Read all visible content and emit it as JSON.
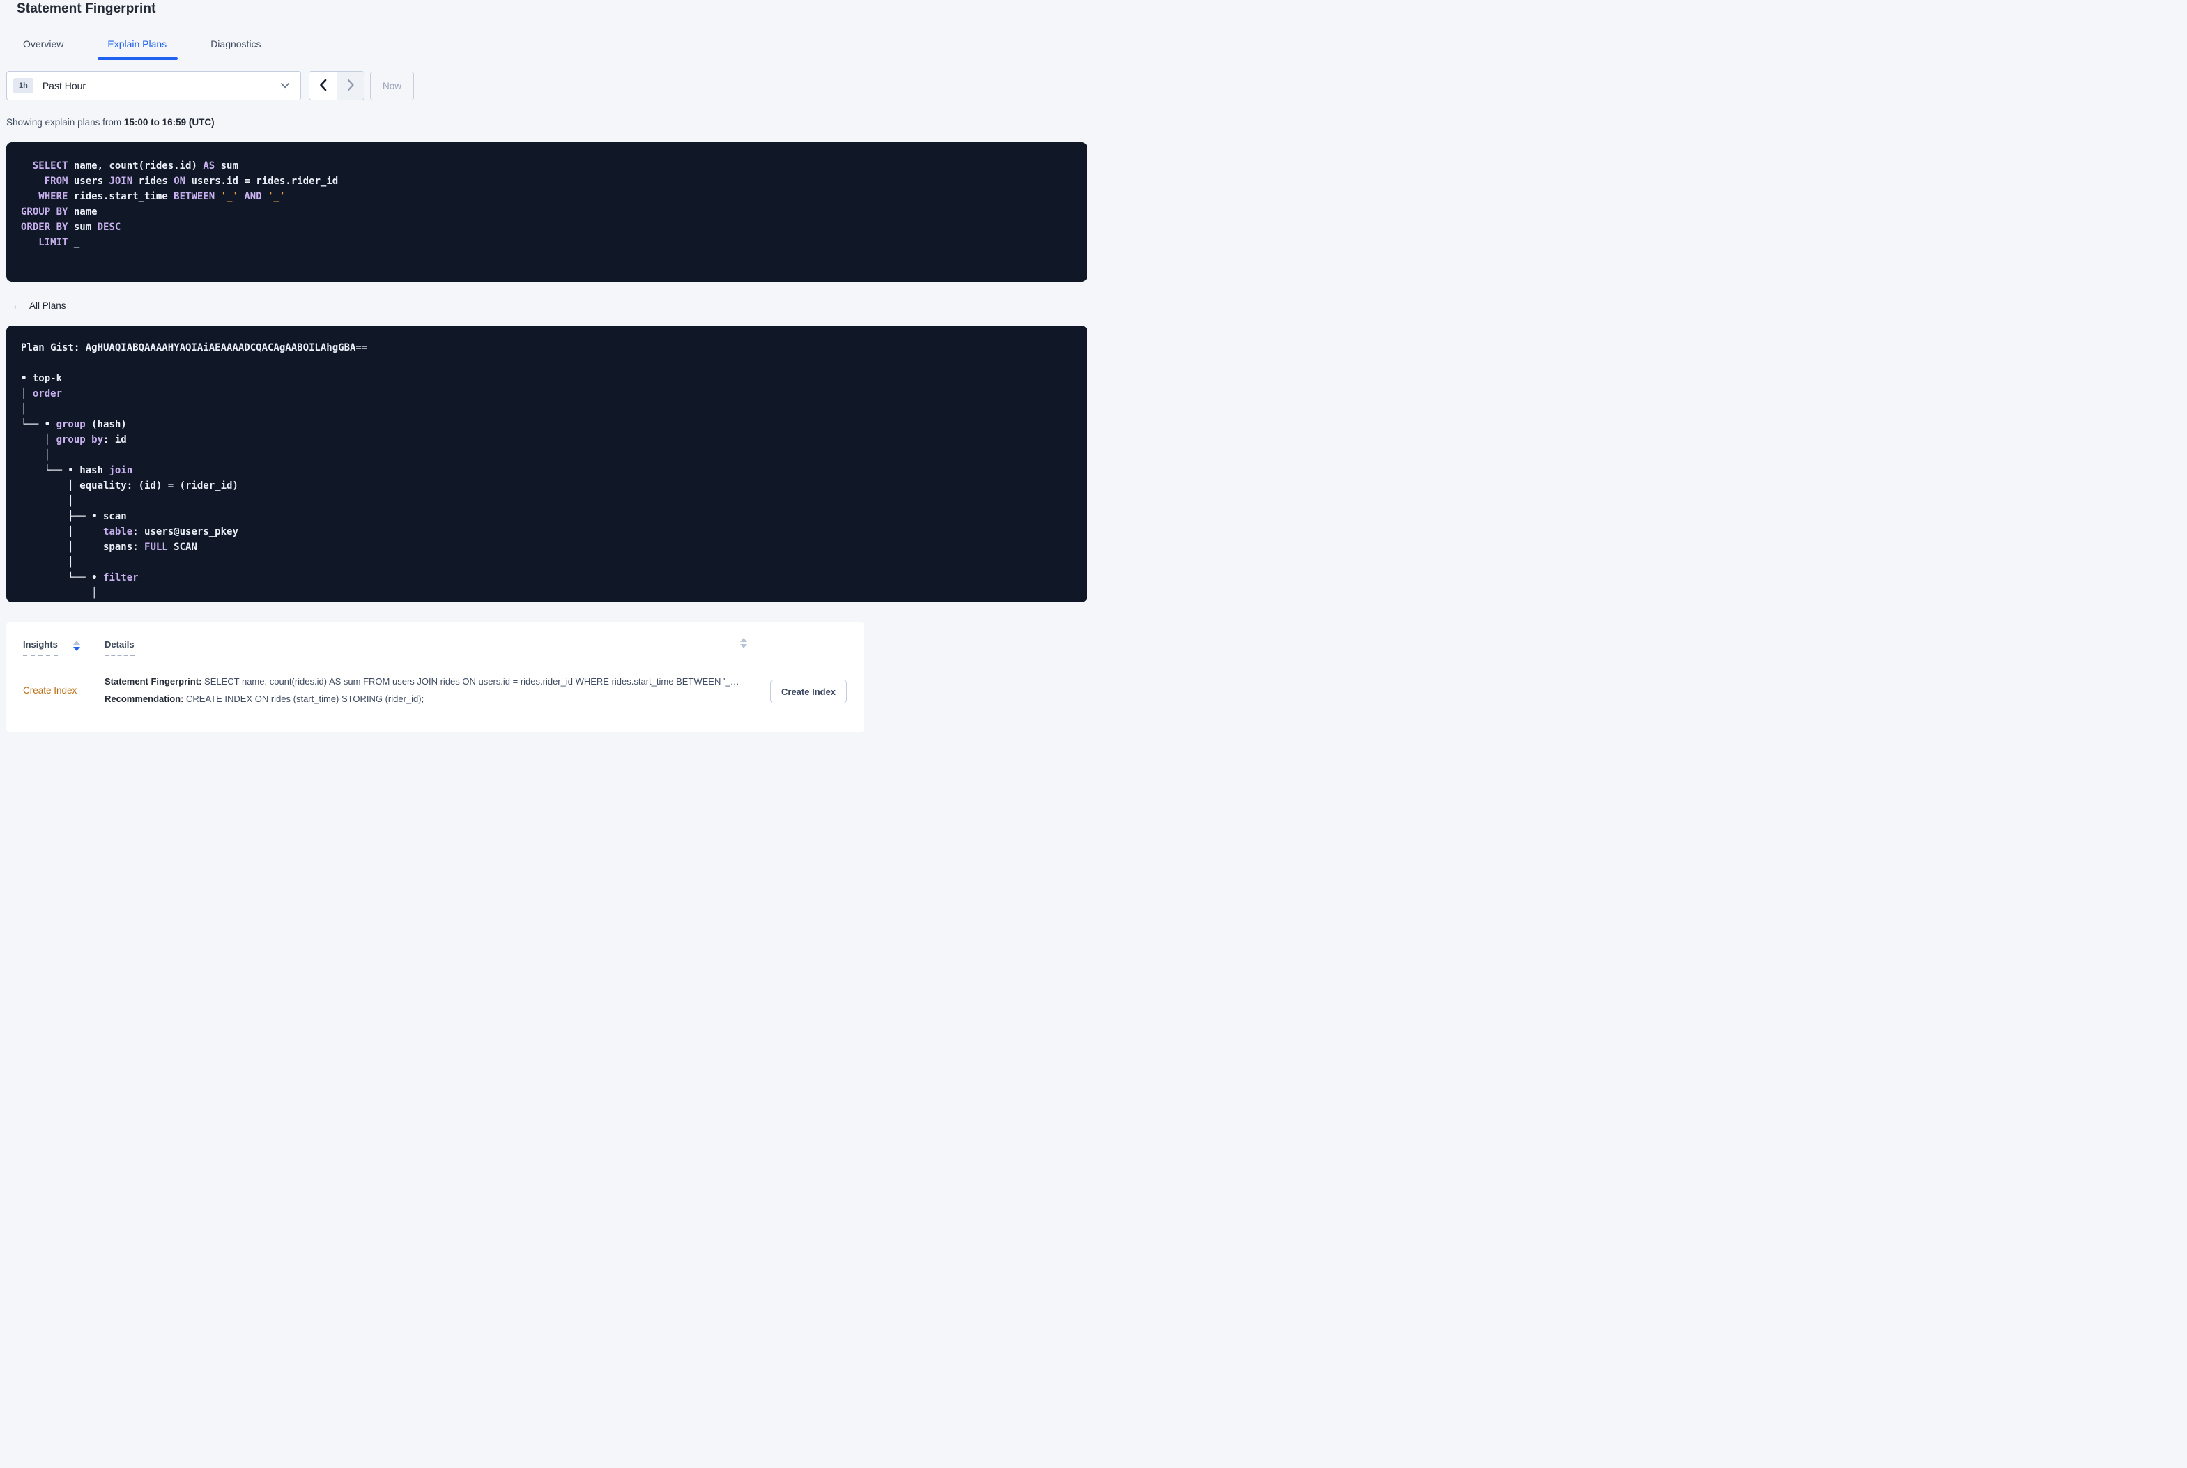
{
  "header": {
    "title": "Statement Fingerprint"
  },
  "tabs": [
    {
      "label": "Overview",
      "active": false
    },
    {
      "label": "Explain Plans",
      "active": true
    },
    {
      "label": "Diagnostics",
      "active": false
    }
  ],
  "time_picker": {
    "interval_badge": "1h",
    "selected_range": "Past Hour",
    "now_label": "Now"
  },
  "summary": {
    "prefix": "Showing explain plans from ",
    "range_bold": "15:00 to 16:59 (UTC)"
  },
  "sql": {
    "lines": [
      [
        [
          "p",
          "  "
        ],
        [
          "k",
          "SELECT"
        ],
        [
          "p",
          " name, count(rides.id) "
        ],
        [
          "k",
          "AS"
        ],
        [
          "p",
          " sum"
        ]
      ],
      [
        [
          "p",
          "    "
        ],
        [
          "k",
          "FROM"
        ],
        [
          "p",
          " users "
        ],
        [
          "k",
          "JOIN"
        ],
        [
          "p",
          " rides "
        ],
        [
          "k",
          "ON"
        ],
        [
          "p",
          " users.id = rides.rider_id"
        ]
      ],
      [
        [
          "p",
          "   "
        ],
        [
          "k",
          "WHERE"
        ],
        [
          "p",
          " rides.start_time "
        ],
        [
          "k",
          "BETWEEN"
        ],
        [
          "p",
          " "
        ],
        [
          "l",
          "'_'"
        ],
        [
          "p",
          " "
        ],
        [
          "k",
          "AND"
        ],
        [
          "p",
          " "
        ],
        [
          "l",
          "'_'"
        ]
      ],
      [
        [
          "k",
          "GROUP BY"
        ],
        [
          "p",
          " name"
        ]
      ],
      [
        [
          "k",
          "ORDER BY"
        ],
        [
          "p",
          " sum "
        ],
        [
          "k",
          "DESC"
        ]
      ],
      [
        [
          "p",
          "   "
        ],
        [
          "k",
          "LIMIT"
        ],
        [
          "p",
          " _"
        ]
      ]
    ]
  },
  "plans_nav": {
    "back_icon": "←",
    "back_label": "All Plans"
  },
  "plan": {
    "gist_line": "Plan Gist: AgHUAQIABQAAAAHYAQIAiAEAAAADCQACAgAABQILAhgGBA==",
    "tree_lines": [
      [
        [
          "p",
          "• top-k"
        ]
      ],
      [
        [
          "p",
          "│ "
        ],
        [
          "k",
          "order"
        ]
      ],
      [
        [
          "p",
          "│"
        ]
      ],
      [
        [
          "p",
          "└── • "
        ],
        [
          "k",
          "group"
        ],
        [
          "p",
          " (hash)"
        ]
      ],
      [
        [
          "p",
          "    │ "
        ],
        [
          "k",
          "group by"
        ],
        [
          "p",
          ": id"
        ]
      ],
      [
        [
          "p",
          "    │"
        ]
      ],
      [
        [
          "p",
          "    └── • hash "
        ],
        [
          "k",
          "join"
        ]
      ],
      [
        [
          "p",
          "        │ equality: (id) = (rider_id)"
        ]
      ],
      [
        [
          "p",
          "        │"
        ]
      ],
      [
        [
          "p",
          "        ├── • scan"
        ]
      ],
      [
        [
          "p",
          "        │     "
        ],
        [
          "k",
          "table"
        ],
        [
          "p",
          ": users@users_pkey"
        ]
      ],
      [
        [
          "p",
          "        │     spans: "
        ],
        [
          "k",
          "FULL"
        ],
        [
          "p",
          " SCAN"
        ]
      ],
      [
        [
          "p",
          "        │"
        ]
      ],
      [
        [
          "p",
          "        └── • "
        ],
        [
          "k",
          "filter"
        ]
      ],
      [
        [
          "p",
          "            │"
        ]
      ]
    ]
  },
  "insights": {
    "col_insights": "Insights",
    "col_details": "Details",
    "rows": [
      {
        "insight_link": "Create Index",
        "fingerprint_label": "Statement Fingerprint:",
        "fingerprint_text": " SELECT name, count(rides.id) AS sum FROM users JOIN rides ON users.id = rides.rider_id WHERE rides.start_time BETWEEN '_…",
        "recommendation_label": "Recommendation:",
        "recommendation_text": " CREATE INDEX ON rides (start_time) STORING (rider_id);",
        "action_button": "Create Index"
      }
    ]
  },
  "colors": {
    "accent_blue": "#2061f0",
    "code_background": "#101828",
    "code_keyword": "#c8b1ee",
    "code_literal": "#f0a440",
    "insight_link_orange": "#bb6e14"
  }
}
